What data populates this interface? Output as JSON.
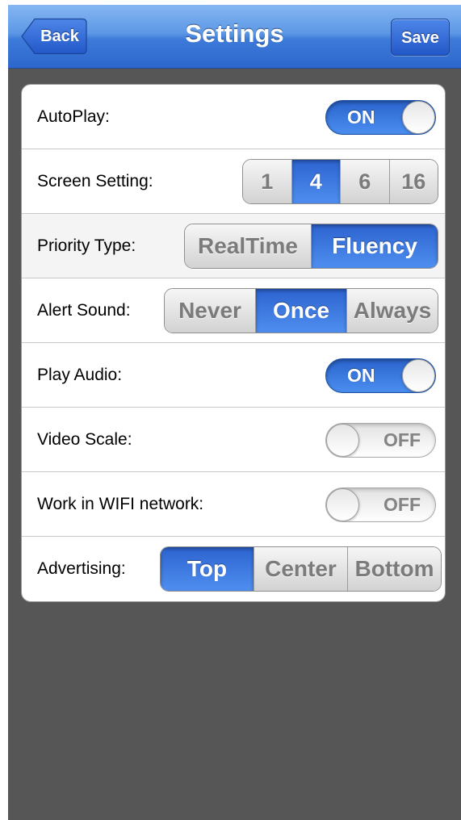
{
  "navbar": {
    "title": "Settings",
    "back_label": "Back",
    "save_label": "Save",
    "color": "#3d7ad9"
  },
  "accent_color": "#3a78e0",
  "settings": {
    "autoplay": {
      "label": "AutoPlay:",
      "state": "ON"
    },
    "screen": {
      "label": "Screen Setting:",
      "options": [
        "1",
        "4",
        "6",
        "16"
      ],
      "selected": "4"
    },
    "priority": {
      "label": "Priority Type:",
      "options": [
        "RealTime",
        "Fluency"
      ],
      "selected": "Fluency"
    },
    "alert_sound": {
      "label": "Alert Sound:",
      "options": [
        "Never",
        "Once",
        "Always"
      ],
      "selected": "Once"
    },
    "play_audio": {
      "label": "Play Audio:",
      "state": "ON"
    },
    "video_scale": {
      "label": "Video Scale:",
      "state": "OFF"
    },
    "wifi": {
      "label": "Work in WIFI network:",
      "state": "OFF"
    },
    "advertising": {
      "label": "Advertising:",
      "options": [
        "Top",
        "Center",
        "Bottom"
      ],
      "selected": "Top"
    }
  }
}
